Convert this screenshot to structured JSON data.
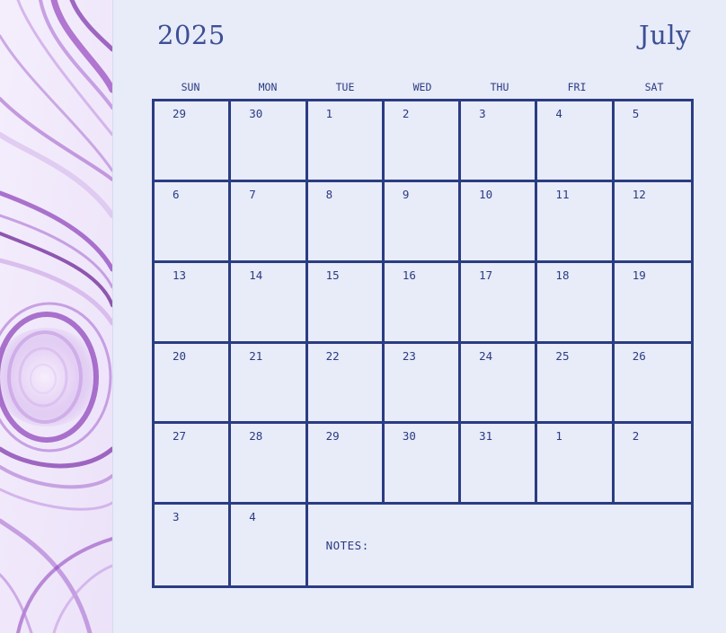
{
  "header": {
    "year": "2025",
    "month": "July"
  },
  "weekdays": [
    "SUN",
    "MON",
    "TUE",
    "WED",
    "THU",
    "FRI",
    "SAT"
  ],
  "weeks": [
    [
      "29",
      "30",
      "1",
      "2",
      "3",
      "4",
      "5"
    ],
    [
      "6",
      "7",
      "8",
      "9",
      "10",
      "11",
      "12"
    ],
    [
      "13",
      "14",
      "15",
      "16",
      "17",
      "18",
      "19"
    ],
    [
      "20",
      "21",
      "22",
      "23",
      "24",
      "25",
      "26"
    ],
    [
      "27",
      "28",
      "29",
      "30",
      "31",
      "1",
      "2"
    ],
    [
      "3",
      "4"
    ]
  ],
  "notes": {
    "label": "NOTES:"
  },
  "colors": {
    "background": "#e8ebf8",
    "ink": "#2a3c82",
    "title": "#3d4f95",
    "marble_purple": "#9b4fc2"
  }
}
